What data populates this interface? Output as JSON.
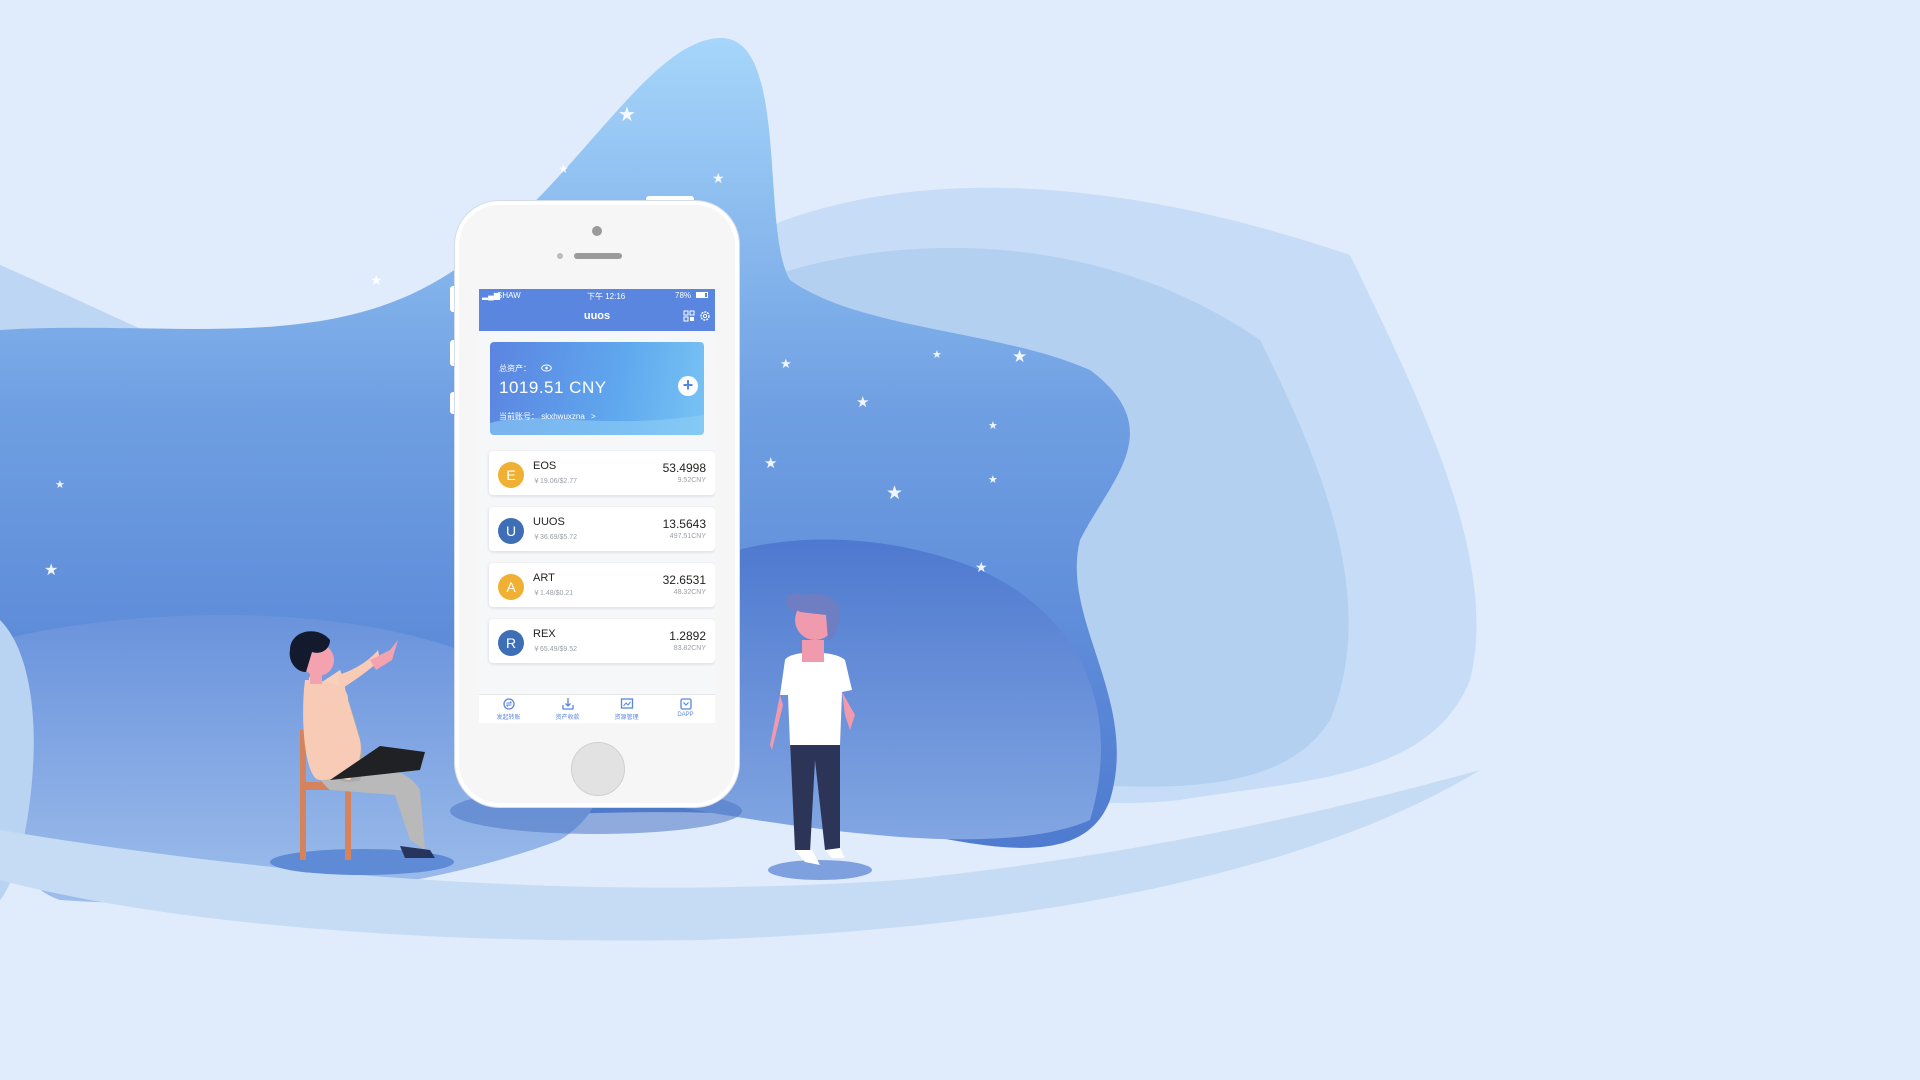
{
  "status_bar": {
    "carrier": "SHAW",
    "time": "下午 12:16",
    "battery": "78%"
  },
  "nav": {
    "title": "uuos"
  },
  "asset_card": {
    "label": "总资产：",
    "value": "1019.51 CNY",
    "account_label": "当前账号：",
    "account_name": "skxhwuxzna",
    "chevron": ">"
  },
  "tokens": [
    {
      "letter": "E",
      "name": "EOS",
      "price": "￥19.06/$2.77",
      "amount": "53.4998",
      "cny": "9.52CNY",
      "color": "#f0b033"
    },
    {
      "letter": "U",
      "name": "UUOS",
      "price": "￥36.69/$5.72",
      "amount": "13.5643",
      "cny": "497.51CNY",
      "color": "#3e6fb6"
    },
    {
      "letter": "A",
      "name": "ART",
      "price": "￥1.48/$0.21",
      "amount": "32.6531",
      "cny": "48.32CNY",
      "color": "#f0b033"
    },
    {
      "letter": "R",
      "name": "REX",
      "price": "￥65.49/$9.52",
      "amount": "1.2892",
      "cny": "83.82CNY",
      "color": "#3e6fb6"
    }
  ],
  "tabs": [
    {
      "label": "发起转账",
      "icon": "transfer-icon"
    },
    {
      "label": "资产收款",
      "icon": "receive-icon"
    },
    {
      "label": "资源管理",
      "icon": "resource-icon"
    },
    {
      "label": "DAPP",
      "icon": "dapp-icon"
    }
  ],
  "colors": {
    "background": "#e0ecfb",
    "primary": "#5a86df",
    "coin_gold": "#f0b033",
    "coin_blue": "#3e6fb6"
  }
}
